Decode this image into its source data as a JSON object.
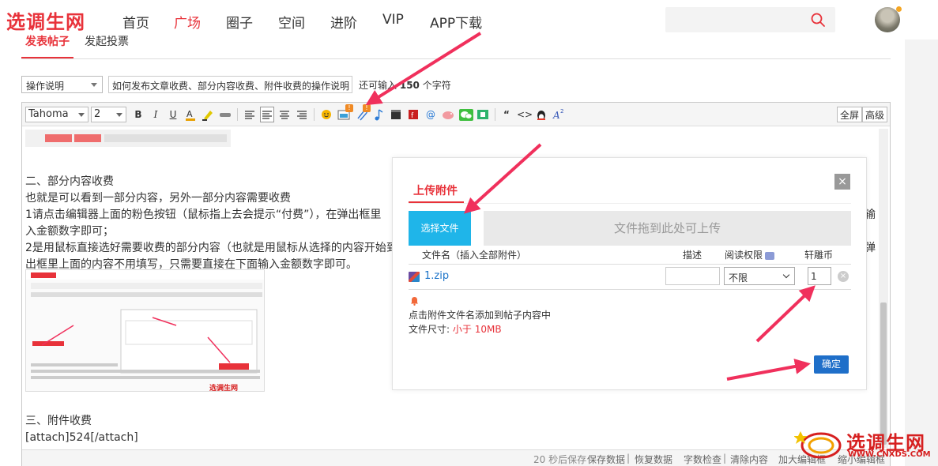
{
  "site": {
    "logo": "选调生网"
  },
  "nav": [
    {
      "label": "首页"
    },
    {
      "label": "广场",
      "active": true
    },
    {
      "label": "圈子"
    },
    {
      "label": "空间"
    },
    {
      "label": "进阶"
    },
    {
      "label": "VIP"
    },
    {
      "label": "APP下载"
    }
  ],
  "subtabs": [
    {
      "label": "发表帖子",
      "active": true
    },
    {
      "label": "发起投票"
    }
  ],
  "form": {
    "type_value": "操作说明",
    "title_value": "如何发布文章收费、部分内容收费、附件收费的操作说明",
    "chars_prefix": "还可输入",
    "chars_count": "150",
    "chars_suffix": "个字符"
  },
  "toolbar": {
    "font": "Tahoma",
    "size": "2",
    "bold": "B",
    "italic": "I",
    "underline": "U",
    "quote": "“",
    "code": "<>",
    "fullscreen": "全屏",
    "advanced": "高级"
  },
  "content": {
    "section2_title": "二、部分内容收费",
    "p1": "也就是可以看到一部分内容，另外一部分内容需要收费",
    "p2": "1请点击编辑器上面的粉色按钮（鼠标指上去会提示“付费”），在弹出框里",
    "p2_tail": "输",
    "p3": "入金额数字即可；",
    "p4": "2是用鼠标直接选好需要收费的部分内容（也就是用鼠标从选择的内容开始到",
    "p4_tail": "弹",
    "p5": "出框里上面的内容不用填写，只需要直接在下面输入金额数字即可。",
    "section3_title": "三、附件收费",
    "attach_code": "[attach]524[/attach]"
  },
  "footer": {
    "autosave": "20 秒后保存",
    "save": "保存数据",
    "restore": "恢复数据",
    "check": "字数检查",
    "clear": "清除内容",
    "enlarge": "加大编辑框",
    "shrink": "缩小编辑框"
  },
  "dialog": {
    "title": "上传附件",
    "close": "×",
    "choose_file": "选择文件",
    "drop_hint": "文件拖到此处可上传",
    "headers": {
      "filename": "文件名（插入全部附件）",
      "desc": "描述",
      "permission": "阅读权限",
      "coin": "轩雕币"
    },
    "file": {
      "name": "1.zip",
      "desc": "",
      "permission": "不限",
      "coin": "1"
    },
    "hint_insert": "点击附件文件名添加到帖子内容中",
    "size_label": "文件尺寸:",
    "size_value": "小于 10MB",
    "confirm": "确定"
  },
  "watermark": {
    "text": "选调生网",
    "url": "WWW.CNXDS.COM"
  },
  "colors": {
    "brand_red": "#e8323a",
    "choose_blue": "#1fb5e9",
    "confirm_blue": "#1f6fc9",
    "arrow_pink": "#f0305c"
  }
}
